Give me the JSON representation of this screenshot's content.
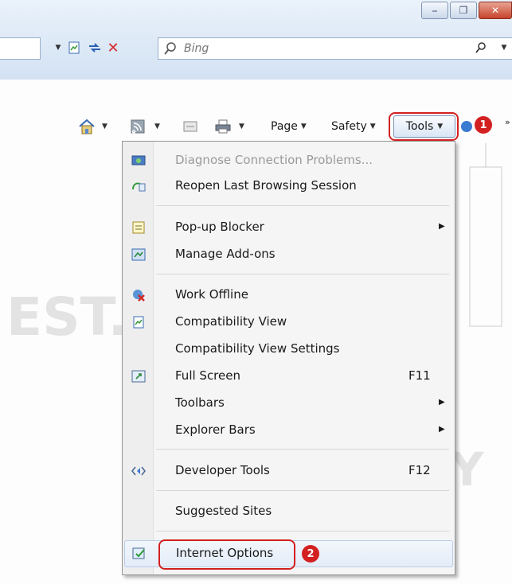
{
  "window": {
    "minimize_icon": "minimize-icon",
    "restore_icon": "restore-icon",
    "close_icon": "close-icon"
  },
  "addressbar": {
    "compat_icon": "compatibility-view-icon",
    "refresh_icon": "refresh-icon",
    "stop_icon": "stop-icon",
    "search_placeholder": "Bing",
    "search_icon": "search-icon"
  },
  "commandbar": {
    "page_label": "Page",
    "safety_label": "Safety",
    "tools_label": "Tools",
    "callout1": "1"
  },
  "tools_menu": {
    "items": [
      {
        "label": "Diagnose Connection Problems...",
        "disabled": true,
        "icon": "diagnose-icon"
      },
      {
        "label": "Reopen Last Browsing Session",
        "icon": "reopen-session-icon"
      },
      {
        "label": "Pop-up Blocker",
        "icon": "popup-blocker-icon",
        "submenu": true
      },
      {
        "label": "Manage Add-ons",
        "icon": "manage-addons-icon"
      },
      {
        "label": "Work Offline",
        "icon": "work-offline-icon"
      },
      {
        "label": "Compatibility View",
        "icon": "compatibility-view-icon"
      },
      {
        "label": "Compatibility View Settings"
      },
      {
        "label": "Full Screen",
        "icon": "full-screen-icon",
        "shortcut": "F11"
      },
      {
        "label": "Toolbars",
        "submenu": true
      },
      {
        "label": "Explorer Bars",
        "submenu": true
      },
      {
        "label": "Developer Tools",
        "icon": "developer-tools-icon",
        "shortcut": "F12"
      },
      {
        "label": "Suggested Sites"
      },
      {
        "label": "Internet Options",
        "icon": "internet-options-icon"
      }
    ],
    "callout2": "2"
  },
  "watermark": {
    "left_text": "EST.",
    "center_text": "WE SECURE Y"
  },
  "colors": {
    "callout_red": "#d32020",
    "chrome_blue": "#dde9f6",
    "menu_bg": "#f5f5f5"
  }
}
